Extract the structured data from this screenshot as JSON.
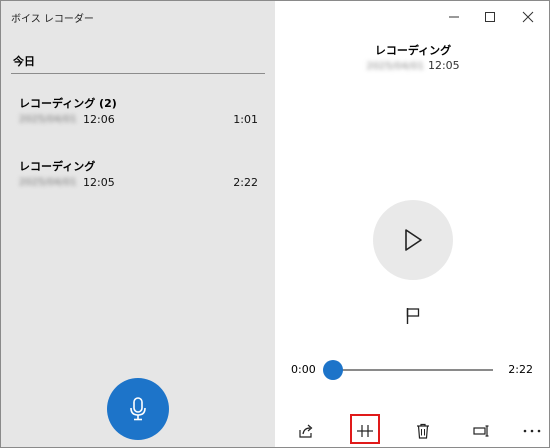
{
  "app": {
    "title": "ボイス レコーダー"
  },
  "list": {
    "section": "今日",
    "items": [
      {
        "title": "レコーディング (2)",
        "date": "2025/04/01",
        "time": "12:06",
        "duration": "1:01"
      },
      {
        "title": "レコーディング",
        "date": "2025/04/01",
        "time": "12:05",
        "duration": "2:22"
      }
    ]
  },
  "detail": {
    "title": "レコーディング",
    "date": "2025/04/01",
    "time": "12:05",
    "position": "0:00",
    "length": "2:22",
    "progress": 0
  },
  "icons": {
    "minimize": "minimize-icon",
    "maximize": "maximize-icon",
    "close": "close-icon",
    "microphone": "microphone-icon",
    "play": "play-icon",
    "flag": "flag-icon",
    "share": "share-icon",
    "trim": "trim-icon",
    "delete": "trash-icon",
    "rename": "rename-icon",
    "more": "more-icon"
  },
  "colors": {
    "accent": "#1d74c9",
    "highlight": "#e01a1a",
    "left_pane": "#e6e6e6"
  }
}
